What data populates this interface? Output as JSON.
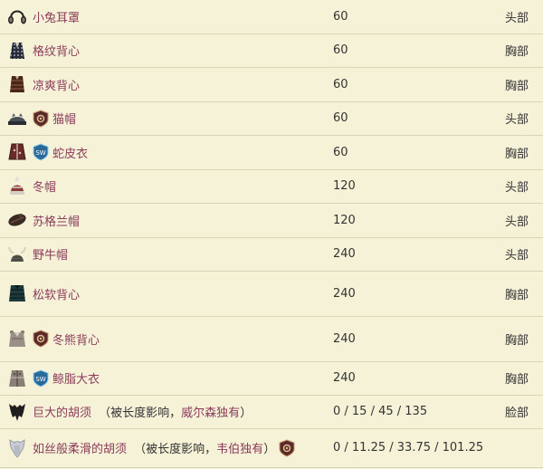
{
  "rows": [
    {
      "name": "小兔耳罩",
      "value": "60",
      "slot": "头部",
      "icon": "earmuffs-icon"
    },
    {
      "name": "格纹背心",
      "value": "60",
      "slot": "胸部",
      "icon": "plaid-vest-icon"
    },
    {
      "name": "凉爽背心",
      "value": "60",
      "slot": "胸部",
      "icon": "summer-vest-icon"
    },
    {
      "name": "猫帽",
      "value": "60",
      "slot": "头部",
      "icon": "cat-cap-icon",
      "badge": "gear-badge-icon"
    },
    {
      "name": "蛇皮衣",
      "value": "60",
      "slot": "胸部",
      "icon": "snakeskin-jacket-icon",
      "badge": "sw-badge-icon",
      "badge_text": "SW"
    },
    {
      "name": "冬帽",
      "value": "120",
      "slot": "头部",
      "icon": "winter-hat-icon"
    },
    {
      "name": "苏格兰帽",
      "value": "120",
      "slot": "头部",
      "icon": "tam-o-shanter-icon"
    },
    {
      "name": "野牛帽",
      "value": "240",
      "slot": "头部",
      "icon": "beefalo-hat-icon"
    },
    {
      "name": "松软背心",
      "value": "240",
      "slot": "胸部",
      "icon": "puffy-vest-icon"
    },
    {
      "name": "冬熊背心",
      "value": "240",
      "slot": "胸部",
      "icon": "bear-vest-icon",
      "badge": "gear-badge-icon"
    },
    {
      "name": "鲸脂大衣",
      "value": "240",
      "slot": "胸部",
      "icon": "blubber-suit-icon",
      "badge": "sw-badge-icon",
      "badge_text": "SW"
    },
    {
      "name": "巨大的胡须",
      "note_pre": "（被长度影响，",
      "note_link": "威尔森独有",
      "note_post": "）",
      "value": "0 / 15 / 45 / 135",
      "slot": "脸部",
      "icon": "big-beard-icon"
    },
    {
      "name": "如丝般柔滑的胡须",
      "note_pre": "（被长度影响，",
      "note_link": "韦伯独有",
      "note_post": "）",
      "value": "0 / 11.25 / 33.75 / 101.25",
      "slot": "",
      "icon": "silky-beard-icon",
      "badge_after": "gear-badge-icon"
    }
  ],
  "colors": {
    "background": "#f5f2d8",
    "link": "#8a3b5a",
    "row_border": "#d9d4b6"
  }
}
